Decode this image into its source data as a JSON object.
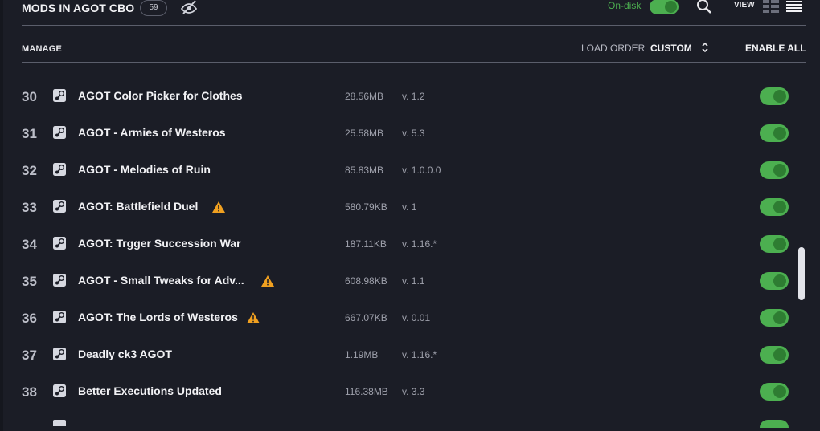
{
  "header": {
    "title": "MODS IN AGOT CBO",
    "count": "59",
    "ondisk_label": "On-disk",
    "ondisk_enabled": true,
    "view_label": "VIEW",
    "icons": [
      "hide-icon",
      "search-icon",
      "grid-view-icon",
      "list-view-icon"
    ]
  },
  "subheader": {
    "manage": "MANAGE",
    "load_order_label": "LOAD ORDER",
    "load_order_value": "CUSTOM",
    "enable_all": "ENABLE ALL"
  },
  "colors": {
    "background": "#1b1d26",
    "accent_green": "#4caf50",
    "warning": "#f0a020"
  },
  "mods": [
    {
      "num": "30",
      "name": "AGOT Color Picker for Clothes",
      "size": "28.56MB",
      "version": "v. 1.2",
      "warning": false,
      "enabled": true
    },
    {
      "num": "31",
      "name": "AGOT - Armies of Westeros",
      "size": "25.58MB",
      "version": "v. 5.3",
      "warning": false,
      "enabled": true
    },
    {
      "num": "32",
      "name": "AGOT - Melodies of Ruin",
      "size": "85.83MB",
      "version": "v. 1.0.0.0",
      "warning": false,
      "enabled": true
    },
    {
      "num": "33",
      "name": "AGOT: Battlefield Duel",
      "size": "580.79KB",
      "version": "v. 1",
      "warning": true,
      "enabled": true
    },
    {
      "num": "34",
      "name": "AGOT: Trgger Succession War",
      "size": "187.11KB",
      "version": "v. 1.16.*",
      "warning": false,
      "enabled": true
    },
    {
      "num": "35",
      "name": "AGOT - Small Tweaks for Adv...",
      "size": "608.98KB",
      "version": "v. 1.1",
      "warning": true,
      "enabled": true
    },
    {
      "num": "36",
      "name": "AGOT: The Lords of Westeros",
      "size": "667.07KB",
      "version": "v. 0.01",
      "warning": true,
      "enabled": true
    },
    {
      "num": "37",
      "name": "Deadly ck3 AGOT",
      "size": "1.19MB",
      "version": "v. 1.16.*",
      "warning": false,
      "enabled": true
    },
    {
      "num": "38",
      "name": "Better Executions Updated",
      "size": "116.38MB",
      "version": "v. 3.3",
      "warning": false,
      "enabled": true
    }
  ]
}
